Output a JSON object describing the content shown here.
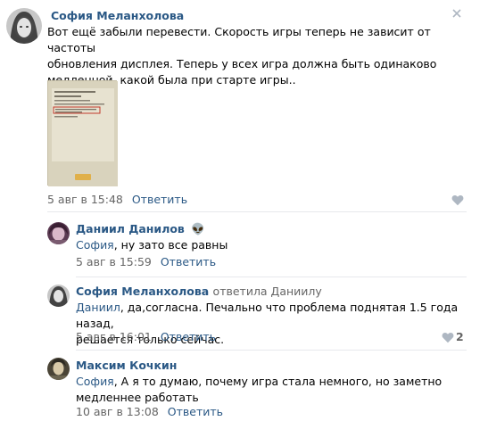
{
  "comments": [
    {
      "author": "София Меланхолова",
      "text_lines": [
        "Вот ещё забыли перевести. Скорость игры теперь не зависит от частоты",
        "обновления дисплея. Теперь у всех игра должна быть одинаково",
        "медленной, какой была при старте игры.."
      ],
      "date": "5 авг в 15:48",
      "reply_label": "Ответить"
    },
    {
      "author": "Даниил Данилов",
      "author_emoji": "👽",
      "mention": "София",
      "text": ", ну зато все равны",
      "date": "5 авг в 15:59",
      "reply_label": "Ответить"
    },
    {
      "author": "София Меланхолова",
      "replied_to": "ответила Даниилу",
      "mention": "Даниил",
      "text_line1": ", да,согласна. Печально что проблема поднятая 1.5 года назад,",
      "text_line2": "решается только сейчас.",
      "date": "5 авг в 16:01",
      "reply_label": "Ответить",
      "likes": "2"
    },
    {
      "author": "Максим Кочкин",
      "mention": "София",
      "text_line1": ", А я то думаю, почему игра стала немного, но заметно",
      "text_line2": "медленнее работать",
      "date": "10 авг в 13:08",
      "reply_label": "Ответить"
    }
  ],
  "colors": {
    "link": "#2a5885",
    "meta": "#656565",
    "separator": "#e7e8ec"
  }
}
